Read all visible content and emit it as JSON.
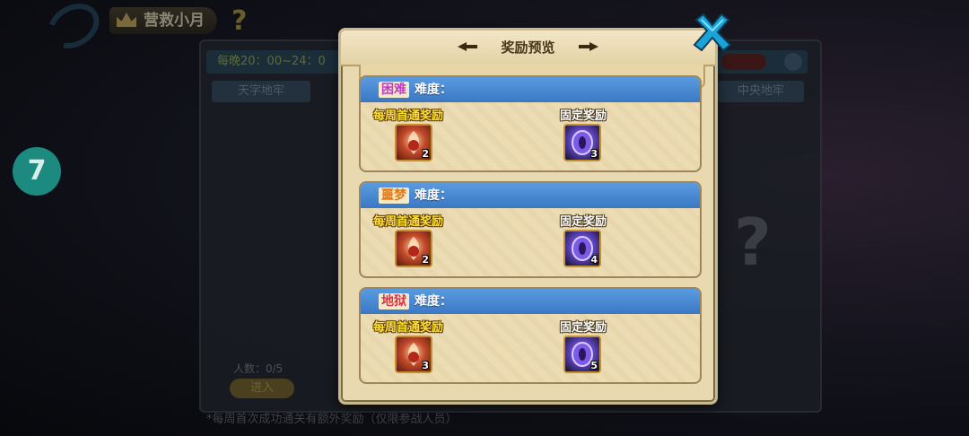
{
  "background": {
    "page_title": "营救小月",
    "help_icon": "question-icon",
    "time_info": "每晚20：00~24：0",
    "dungeon_left": "天字地牢",
    "dungeon_right": "中央地牢",
    "round_number": "7",
    "people_count": "人数：0/5",
    "enter_button": "进入",
    "footnote": "*每周首次成功通关有额外奖励（仅限参战人员）"
  },
  "modal": {
    "title": "奖励预览",
    "close_icon": "close-x-icon",
    "sections": [
      {
        "difficulty": "困难",
        "difficulty_color": "#c23cc8",
        "difficulty_suffix": "难度：",
        "weekly_label": "每周首通奖励",
        "fixed_label": "固定奖励",
        "weekly_item": {
          "icon": "phoenix-feather-icon",
          "qty": "2"
        },
        "fixed_item": {
          "icon": "purple-eye-gem-icon",
          "qty": "3"
        }
      },
      {
        "difficulty": "噩梦",
        "difficulty_color": "#e07a1c",
        "difficulty_suffix": "难度：",
        "weekly_label": "每周首通奖励",
        "fixed_label": "固定奖励",
        "weekly_item": {
          "icon": "phoenix-feather-icon",
          "qty": "2"
        },
        "fixed_item": {
          "icon": "purple-eye-gem-icon",
          "qty": "4"
        }
      },
      {
        "difficulty": "地狱",
        "difficulty_color": "#d8334a",
        "difficulty_suffix": "难度：",
        "weekly_label": "每周首通奖励",
        "fixed_label": "固定奖励",
        "weekly_item": {
          "icon": "phoenix-feather-icon",
          "qty": "3"
        },
        "fixed_item": {
          "icon": "purple-eye-gem-icon",
          "qty": "5"
        }
      }
    ]
  }
}
